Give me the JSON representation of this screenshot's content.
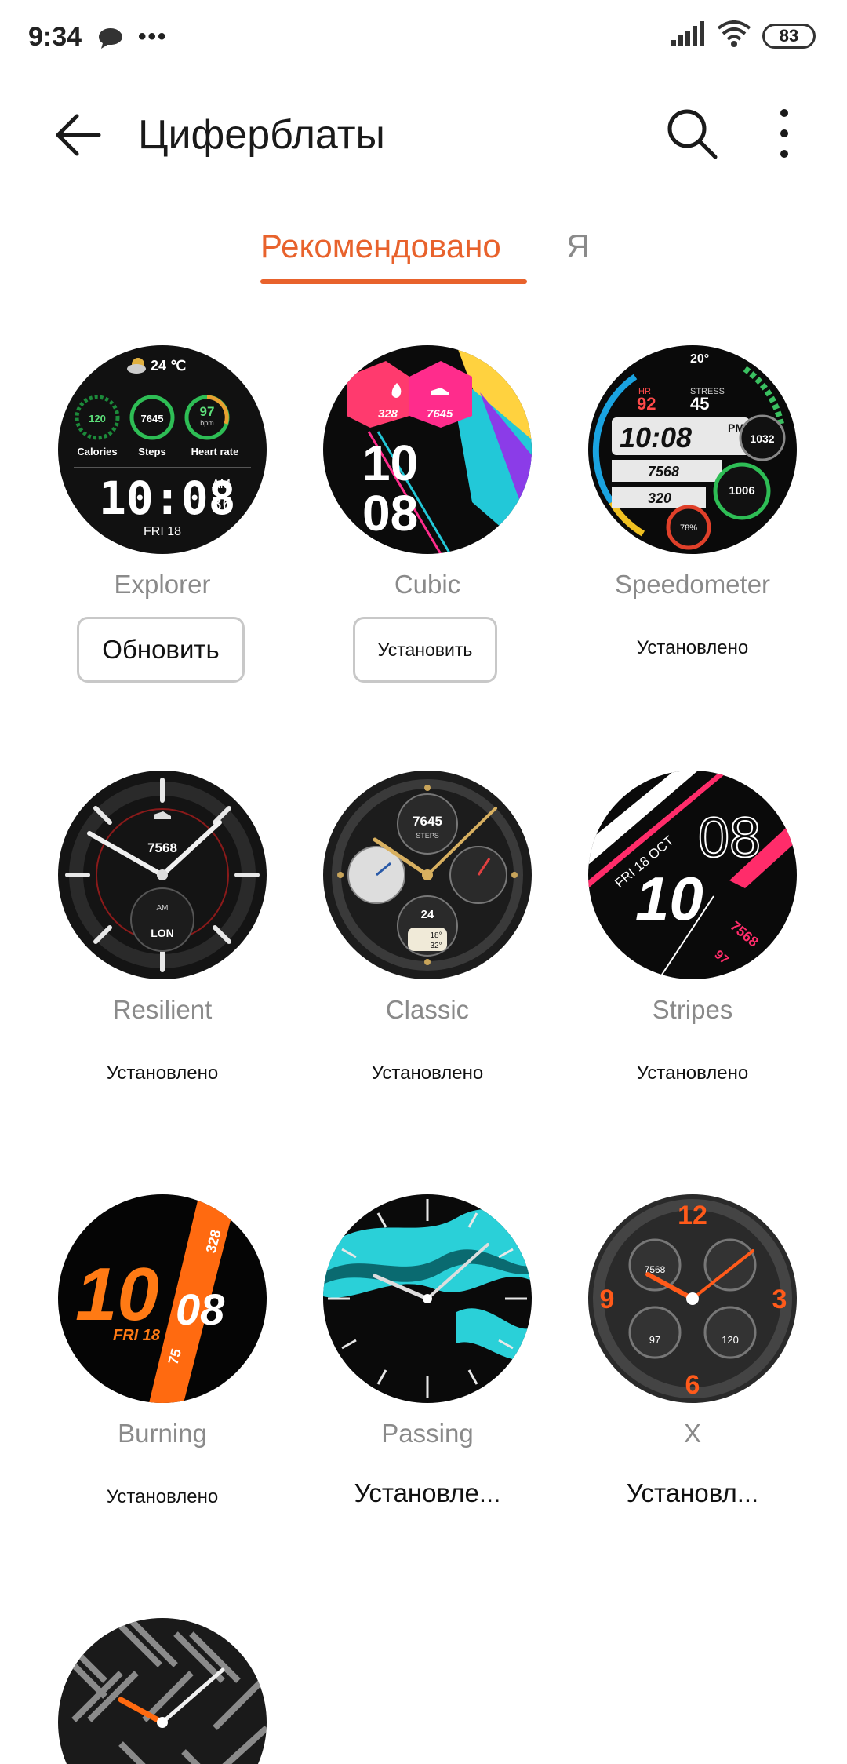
{
  "status_bar": {
    "time": "9:34",
    "dots": "•••",
    "battery": "83",
    "icons": [
      "chat-icon",
      "signal-icon",
      "wifi-icon",
      "battery-icon"
    ]
  },
  "app_bar": {
    "title": "Циферблаты",
    "icons": [
      "back-arrow-icon",
      "search-icon",
      "more-vertical-icon"
    ]
  },
  "tabs": [
    {
      "label": "Рекомендовано",
      "active": true
    },
    {
      "label": "Я",
      "active": false
    }
  ],
  "accent_color": "#e8622c",
  "faces": [
    {
      "name": "Explorer",
      "action": "Обновить",
      "face_text": {
        "temp": "24 ℃",
        "calories_value": "120",
        "steps_value": "7645",
        "hr_value": "97",
        "hr_unit": "bpm",
        "calories_label": "Calories",
        "steps_label": "Steps",
        "hr_label": "Heart rate",
        "time": "10:08",
        "ampm": "AM",
        "seconds": "36",
        "date": "FRI 18"
      }
    },
    {
      "name": "Cubic",
      "action": "Установить",
      "face_text": {
        "cal": "328",
        "steps": "7645",
        "hour": "10",
        "minute": "08"
      }
    },
    {
      "name": "Speedometer",
      "action": "Установлено",
      "face_text": {
        "temp": "20°",
        "hr_label": "HR",
        "hr": "92",
        "stress_label": "STRESS",
        "stress": "45",
        "time": "10:08",
        "ampm": "PM",
        "steps": "7568",
        "cal": "320",
        "baro": "1032",
        "alti": "1006",
        "battery": "78%"
      }
    },
    {
      "name": "Resilient",
      "action": "Установлено",
      "face_text": {
        "steps": "7568",
        "ampm": "AM",
        "city": "LON"
      }
    },
    {
      "name": "Classic",
      "action": "Установлено",
      "face_text": {
        "steps": "7645",
        "steps_label": "STEPS",
        "day": "24",
        "temp_high": "18°",
        "temp_low": "32°"
      }
    },
    {
      "name": "Stripes",
      "action": "Установлено",
      "face_text": {
        "date": "FRI 18 OCT",
        "hour": "10",
        "minute": "08",
        "steps": "7568",
        "hr": "97"
      }
    },
    {
      "name": "Burning",
      "action": "Установлено",
      "face_text": {
        "hour": "10",
        "minute": "08",
        "date": "FRI 18",
        "cal": "328",
        "hr": "75"
      }
    },
    {
      "name": "Passing",
      "action": "Установле...",
      "face_text": {}
    },
    {
      "name": "X",
      "action": "Установл...",
      "face_text": {
        "n12": "12",
        "n3": "3",
        "n6": "6",
        "n9": "9",
        "steps": "7568",
        "hr": "97",
        "cal": "120"
      }
    },
    {
      "name": "",
      "action": "",
      "face_text": {}
    }
  ]
}
